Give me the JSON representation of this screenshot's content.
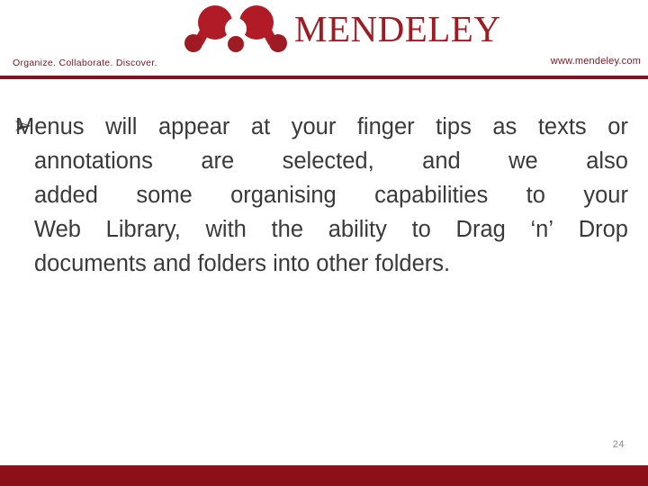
{
  "header": {
    "logo_icon": "mendeley-molecule-logo",
    "logo_wordmark": "MENDELEY",
    "logo_color": "#9E1B24",
    "tagline": "Organize. Collaborate. Discover.",
    "website": "www.mendeley.com",
    "rule_color": "#7D1420"
  },
  "body": {
    "bullet_marker": "➢",
    "bullet_text": "Menus will appear at your finger tips as texts or annotations are selected, and we also added some organising capabilities to your Web Library, with the ability to Drag ‘n’ Drop documents and folders into other folders.",
    "lines": [
      {
        "words": [
          "Menus",
          "will",
          "appear",
          "at",
          "your",
          "finger",
          "tips",
          "as",
          "texts",
          "or"
        ],
        "justified": true
      },
      {
        "words": [
          "annotations",
          "are",
          "selected,",
          "and",
          "we",
          "also"
        ],
        "justified": true
      },
      {
        "words": [
          "added",
          "some",
          "organising",
          "capabilities",
          "to",
          "your"
        ],
        "justified": true
      },
      {
        "words": [
          "Web",
          "Library,",
          "with",
          "the",
          "ability",
          "to",
          "Drag",
          "‘n’",
          "Drop"
        ],
        "justified": true
      },
      {
        "words": [
          "documents",
          "and",
          "folders",
          "into",
          "other",
          "folders."
        ],
        "justified": false
      }
    ],
    "text_color": "#3a3a3a"
  },
  "footer": {
    "page_number": "24",
    "bar_color": "#8B1017"
  }
}
